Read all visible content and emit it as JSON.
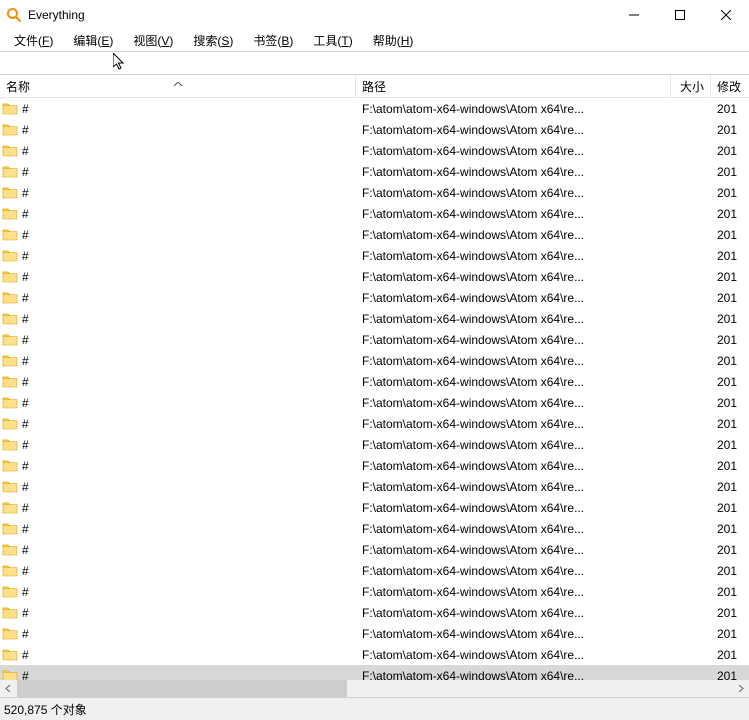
{
  "window": {
    "title": "Everything"
  },
  "menu": {
    "file": {
      "label": "文件(",
      "accel": "F",
      "suffix": ")"
    },
    "edit": {
      "label": "编辑(",
      "accel": "E",
      "suffix": ")"
    },
    "view": {
      "label": "视图(",
      "accel": "V",
      "suffix": ")"
    },
    "search": {
      "label": "搜索(",
      "accel": "S",
      "suffix": ")"
    },
    "bookmark": {
      "label": "书签(",
      "accel": "B",
      "suffix": ")"
    },
    "tools": {
      "label": "工具(",
      "accel": "T",
      "suffix": ")"
    },
    "help": {
      "label": "帮助(",
      "accel": "H",
      "suffix": ")"
    }
  },
  "searchValue": "",
  "columns": {
    "name": "名称",
    "path": "路径",
    "size": "大小",
    "modified": "修改"
  },
  "rows": [
    {
      "name": "#",
      "path": "F:\\atom\\atom-x64-windows\\Atom x64\\re...",
      "size": "",
      "mod": "201",
      "selected": false
    },
    {
      "name": "#",
      "path": "F:\\atom\\atom-x64-windows\\Atom x64\\re...",
      "size": "",
      "mod": "201",
      "selected": false
    },
    {
      "name": "#",
      "path": "F:\\atom\\atom-x64-windows\\Atom x64\\re...",
      "size": "",
      "mod": "201",
      "selected": false
    },
    {
      "name": "#",
      "path": "F:\\atom\\atom-x64-windows\\Atom x64\\re...",
      "size": "",
      "mod": "201",
      "selected": false
    },
    {
      "name": "#",
      "path": "F:\\atom\\atom-x64-windows\\Atom x64\\re...",
      "size": "",
      "mod": "201",
      "selected": false
    },
    {
      "name": "#",
      "path": "F:\\atom\\atom-x64-windows\\Atom x64\\re...",
      "size": "",
      "mod": "201",
      "selected": false
    },
    {
      "name": "#",
      "path": "F:\\atom\\atom-x64-windows\\Atom x64\\re...",
      "size": "",
      "mod": "201",
      "selected": false
    },
    {
      "name": "#",
      "path": "F:\\atom\\atom-x64-windows\\Atom x64\\re...",
      "size": "",
      "mod": "201",
      "selected": false
    },
    {
      "name": "#",
      "path": "F:\\atom\\atom-x64-windows\\Atom x64\\re...",
      "size": "",
      "mod": "201",
      "selected": false
    },
    {
      "name": "#",
      "path": "F:\\atom\\atom-x64-windows\\Atom x64\\re...",
      "size": "",
      "mod": "201",
      "selected": false
    },
    {
      "name": "#",
      "path": "F:\\atom\\atom-x64-windows\\Atom x64\\re...",
      "size": "",
      "mod": "201",
      "selected": false
    },
    {
      "name": "#",
      "path": "F:\\atom\\atom-x64-windows\\Atom x64\\re...",
      "size": "",
      "mod": "201",
      "selected": false
    },
    {
      "name": "#",
      "path": "F:\\atom\\atom-x64-windows\\Atom x64\\re...",
      "size": "",
      "mod": "201",
      "selected": false
    },
    {
      "name": "#",
      "path": "F:\\atom\\atom-x64-windows\\Atom x64\\re...",
      "size": "",
      "mod": "201",
      "selected": false
    },
    {
      "name": "#",
      "path": "F:\\atom\\atom-x64-windows\\Atom x64\\re...",
      "size": "",
      "mod": "201",
      "selected": false
    },
    {
      "name": "#",
      "path": "F:\\atom\\atom-x64-windows\\Atom x64\\re...",
      "size": "",
      "mod": "201",
      "selected": false
    },
    {
      "name": "#",
      "path": "F:\\atom\\atom-x64-windows\\Atom x64\\re...",
      "size": "",
      "mod": "201",
      "selected": false
    },
    {
      "name": "#",
      "path": "F:\\atom\\atom-x64-windows\\Atom x64\\re...",
      "size": "",
      "mod": "201",
      "selected": false
    },
    {
      "name": "#",
      "path": "F:\\atom\\atom-x64-windows\\Atom x64\\re...",
      "size": "",
      "mod": "201",
      "selected": false
    },
    {
      "name": "#",
      "path": "F:\\atom\\atom-x64-windows\\Atom x64\\re...",
      "size": "",
      "mod": "201",
      "selected": false
    },
    {
      "name": "#",
      "path": "F:\\atom\\atom-x64-windows\\Atom x64\\re...",
      "size": "",
      "mod": "201",
      "selected": false
    },
    {
      "name": "#",
      "path": "F:\\atom\\atom-x64-windows\\Atom x64\\re...",
      "size": "",
      "mod": "201",
      "selected": false
    },
    {
      "name": "#",
      "path": "F:\\atom\\atom-x64-windows\\Atom x64\\re...",
      "size": "",
      "mod": "201",
      "selected": false
    },
    {
      "name": "#",
      "path": "F:\\atom\\atom-x64-windows\\Atom x64\\re...",
      "size": "",
      "mod": "201",
      "selected": false
    },
    {
      "name": "#",
      "path": "F:\\atom\\atom-x64-windows\\Atom x64\\re...",
      "size": "",
      "mod": "201",
      "selected": false
    },
    {
      "name": "#",
      "path": "F:\\atom\\atom-x64-windows\\Atom x64\\re...",
      "size": "",
      "mod": "201",
      "selected": false
    },
    {
      "name": "#",
      "path": "F:\\atom\\atom-x64-windows\\Atom x64\\re...",
      "size": "",
      "mod": "201",
      "selected": false
    },
    {
      "name": "#",
      "path": "F:\\atom\\atom-x64-windows\\Atom x64\\re...",
      "size": "",
      "mod": "201",
      "selected": true
    }
  ],
  "status": "520,875 个对象"
}
